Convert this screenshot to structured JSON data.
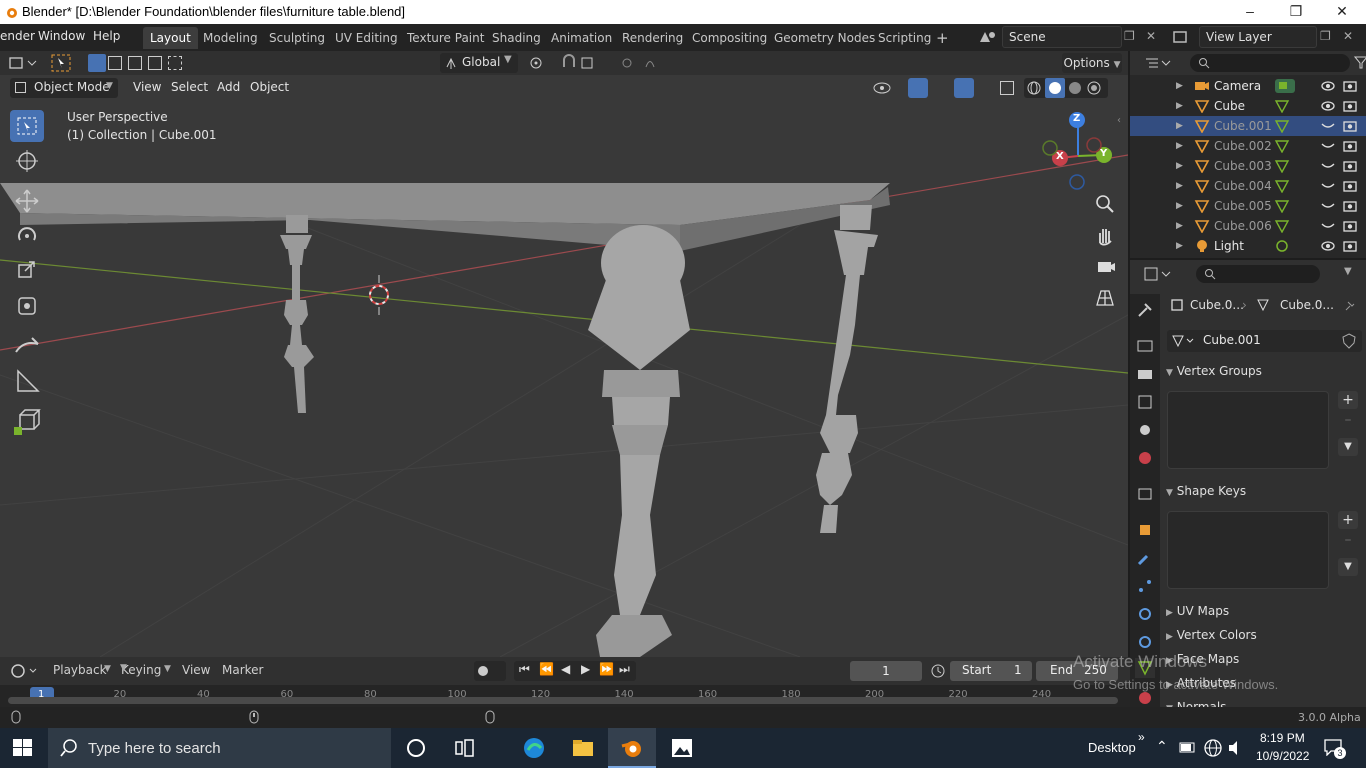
{
  "window": {
    "title": "Blender* [D:\\Blender Foundation\\blender files\\furniture table.blend]",
    "controls": [
      "minimize",
      "maximize",
      "close"
    ]
  },
  "menubar": {
    "items": [
      "ender",
      "Window",
      "Help"
    ]
  },
  "workspaces": {
    "tabs": [
      "Layout",
      "Modeling",
      "Sculpting",
      "UV Editing",
      "Texture Paint",
      "Shading",
      "Animation",
      "Rendering",
      "Compositing",
      "Geometry Nodes",
      "Scripting"
    ],
    "active": "Layout",
    "add_label": "+"
  },
  "scene": {
    "name": "Scene",
    "view_layer": "View Layer"
  },
  "tool_header": {
    "orientation": "Global",
    "options_label": "Options"
  },
  "viewport_header": {
    "mode": "Object Mode",
    "menus": [
      "View",
      "Select",
      "Add",
      "Object"
    ]
  },
  "viewport": {
    "perspective_label": "User Perspective",
    "collection_label": "(1) Collection | Cube.001",
    "gizmo_axes": [
      "X",
      "Y",
      "Z"
    ]
  },
  "outliner": {
    "rows": [
      {
        "name": "Camera",
        "selected": false,
        "dim": false
      },
      {
        "name": "Cube",
        "selected": false,
        "dim": false
      },
      {
        "name": "Cube.001",
        "selected": true,
        "dim": true
      },
      {
        "name": "Cube.002",
        "selected": false,
        "dim": true
      },
      {
        "name": "Cube.003",
        "selected": false,
        "dim": true
      },
      {
        "name": "Cube.004",
        "selected": false,
        "dim": true
      },
      {
        "name": "Cube.005",
        "selected": false,
        "dim": true
      },
      {
        "name": "Cube.006",
        "selected": false,
        "dim": true
      },
      {
        "name": "Light",
        "selected": false,
        "dim": false
      }
    ]
  },
  "properties": {
    "breadcrumb_object": "Cube.0...",
    "breadcrumb_data": "Cube.0...",
    "mesh_name": "Cube.001",
    "panels": [
      "Vertex Groups",
      "Shape Keys",
      "UV Maps",
      "Vertex Colors",
      "Face Maps",
      "Attributes",
      "Normals"
    ]
  },
  "timeline": {
    "menus": [
      "Playback",
      "Keying",
      "View",
      "Marker"
    ],
    "current_frame": "1",
    "start_label": "Start",
    "start_value": "1",
    "end_label": "End",
    "end_value": "250",
    "ruler_marks": [
      "1",
      "20",
      "40",
      "60",
      "80",
      "100",
      "120",
      "140",
      "160",
      "180",
      "200",
      "220",
      "240"
    ]
  },
  "status": {
    "version": "3.0.0 Alpha"
  },
  "watermark": {
    "line1": "Activate Windows",
    "line2": "Go to Settings to activate Windows."
  },
  "taskbar": {
    "search_placeholder": "Type here to search",
    "desktop_label": "Desktop",
    "time": "8:19 PM",
    "date": "10/9/2022",
    "notification_count": "3"
  },
  "colors": {
    "accent": "#4772b3",
    "viewport_bg": "#393939",
    "x_axis": "#c8404a",
    "y_axis": "#7ab42c",
    "z_axis": "#3d7fe0"
  }
}
